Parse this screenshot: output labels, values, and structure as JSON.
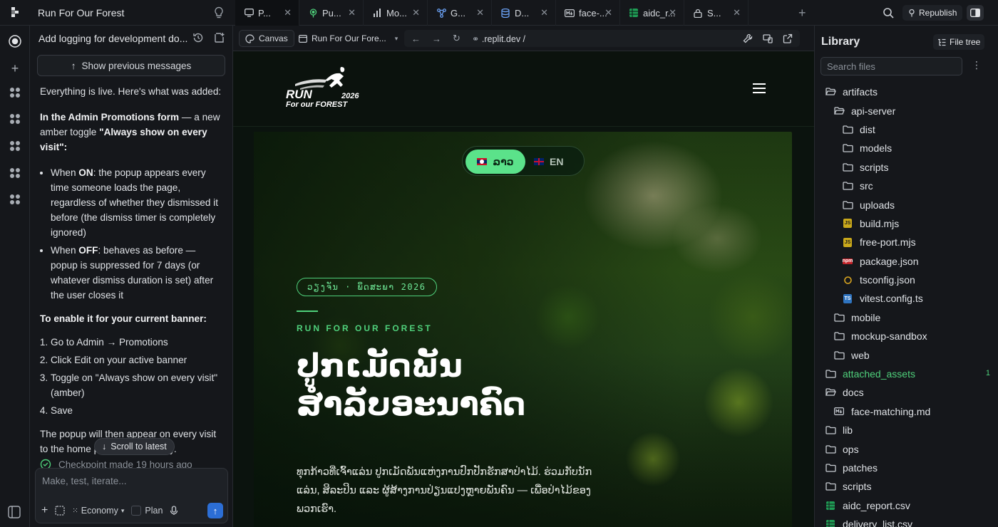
{
  "topbar": {
    "project_title": "Run For Our Forest",
    "tabs": [
      {
        "label": "P...",
        "icon": "monitor-icon"
      },
      {
        "label": "Pu...",
        "icon": "broadcast-icon"
      },
      {
        "label": "Mo...",
        "icon": "bar-chart-icon"
      },
      {
        "label": "G...",
        "icon": "graph-nodes-icon"
      },
      {
        "label": "D...",
        "icon": "database-icon"
      },
      {
        "label": "face-...",
        "icon": "markdown-file-icon"
      },
      {
        "label": "aidc_r...",
        "icon": "spreadsheet-icon"
      },
      {
        "label": "S...",
        "icon": "lock-icon"
      }
    ],
    "republish_label": "Republish"
  },
  "chat": {
    "header_title": "Add logging for development do...",
    "show_previous_label": "Show previous messages",
    "intro": "Everything is live. Here's what was added:",
    "section1_bold": "In the Admin Promotions form",
    "section1_text": " — a new amber toggle ",
    "section1_toggle": "\"Always show on every visit\"",
    "section1_end": ":",
    "bullet1_pre": "When ",
    "bullet1_bold": "ON",
    "bullet1_text": ": the popup appears every time someone loads the page, regardless of whether they dismissed it before (the dismiss timer is completely ignored)",
    "bullet2_pre": "When ",
    "bullet2_bold": "OFF",
    "bullet2_text": ": behaves as before — popup is suppressed for 7 days (or whatever dismiss duration is set) after the user closes it",
    "enable_heading": "To enable it for your current banner:",
    "steps": [
      "Go to Admin → Promotions",
      "Click Edit on your active banner",
      "Toggle on \"Always show on every visit\" (amber)",
      "Save"
    ],
    "closing": "The popup will then appear on every visit to the home page automatically.",
    "scroll_latest_label": "Scroll to latest",
    "checkpoint": "Checkpoint made 19 hours ago",
    "input_placeholder": "Make, test, iterate...",
    "mode_label": "Economy",
    "plan_label": "Plan"
  },
  "preview": {
    "canvas_label": "Canvas",
    "page_label": "Run For Our Fore...",
    "url": ".replit.dev /"
  },
  "site": {
    "logo_line1": "RUN",
    "logo_year": "2026",
    "logo_line2": "For our FOREST",
    "lang_lo": "ລາວ",
    "lang_en": "EN",
    "date_pill": "ວຽງຈັນ · ພຶດສະພາ 2026",
    "kicker": "RUN FOR OUR FOREST",
    "title_line1": "ປູກເມັດພັນ",
    "title_line2": "ສຳລັບອະນາຄົດ",
    "description": "ທຸກກ້າວທີ່ເຈົ້າແລ່ນ ປູກເມັດພັນແຫ່ງການປົກປັກຮັກສາປ່າໄມ້. ຮ່ວມກັບນັກແລ່ນ, ສິລະປິນ ແລະ ຜູ້ສ້າງການປ່ຽນແປງຫຼາຍພັນຄົນ — ເພື່ອປ່າໄມ້ຂອງພວກເຮົາ."
  },
  "library": {
    "title": "Library",
    "file_tree_label": "File tree",
    "search_placeholder": "Search files",
    "tree": [
      {
        "name": "artifacts",
        "type": "folder-open",
        "depth": 0
      },
      {
        "name": "api-server",
        "type": "folder-open",
        "depth": 1
      },
      {
        "name": "dist",
        "type": "folder",
        "depth": 2
      },
      {
        "name": "models",
        "type": "folder",
        "depth": 2
      },
      {
        "name": "scripts",
        "type": "folder",
        "depth": 2
      },
      {
        "name": "src",
        "type": "folder",
        "depth": 2
      },
      {
        "name": "uploads",
        "type": "folder",
        "depth": 2
      },
      {
        "name": "build.mjs",
        "type": "js",
        "depth": 2
      },
      {
        "name": "free-port.mjs",
        "type": "js",
        "depth": 2
      },
      {
        "name": "package.json",
        "type": "npm",
        "depth": 2
      },
      {
        "name": "tsconfig.json",
        "type": "tsconfig",
        "depth": 2
      },
      {
        "name": "vitest.config.ts",
        "type": "ts",
        "depth": 2
      },
      {
        "name": "mobile",
        "type": "folder",
        "depth": 1
      },
      {
        "name": "mockup-sandbox",
        "type": "folder",
        "depth": 1
      },
      {
        "name": "web",
        "type": "folder",
        "depth": 1
      },
      {
        "name": "attached_assets",
        "type": "folder",
        "depth": 0,
        "highlight": true,
        "badge": "1"
      },
      {
        "name": "docs",
        "type": "folder-open",
        "depth": 0
      },
      {
        "name": "face-matching.md",
        "type": "md",
        "depth": 1
      },
      {
        "name": "lib",
        "type": "folder",
        "depth": 0
      },
      {
        "name": "ops",
        "type": "folder",
        "depth": 0
      },
      {
        "name": "patches",
        "type": "folder",
        "depth": 0
      },
      {
        "name": "scripts",
        "type": "folder",
        "depth": 0
      },
      {
        "name": "aidc_report.csv",
        "type": "csv",
        "depth": 0
      },
      {
        "name": "delivery_list.csv",
        "type": "csv",
        "depth": 0
      }
    ]
  },
  "colors": {
    "accent_green": "#4fd07b",
    "lang_active": "#5be28a",
    "send_blue": "#2c6ed5"
  }
}
